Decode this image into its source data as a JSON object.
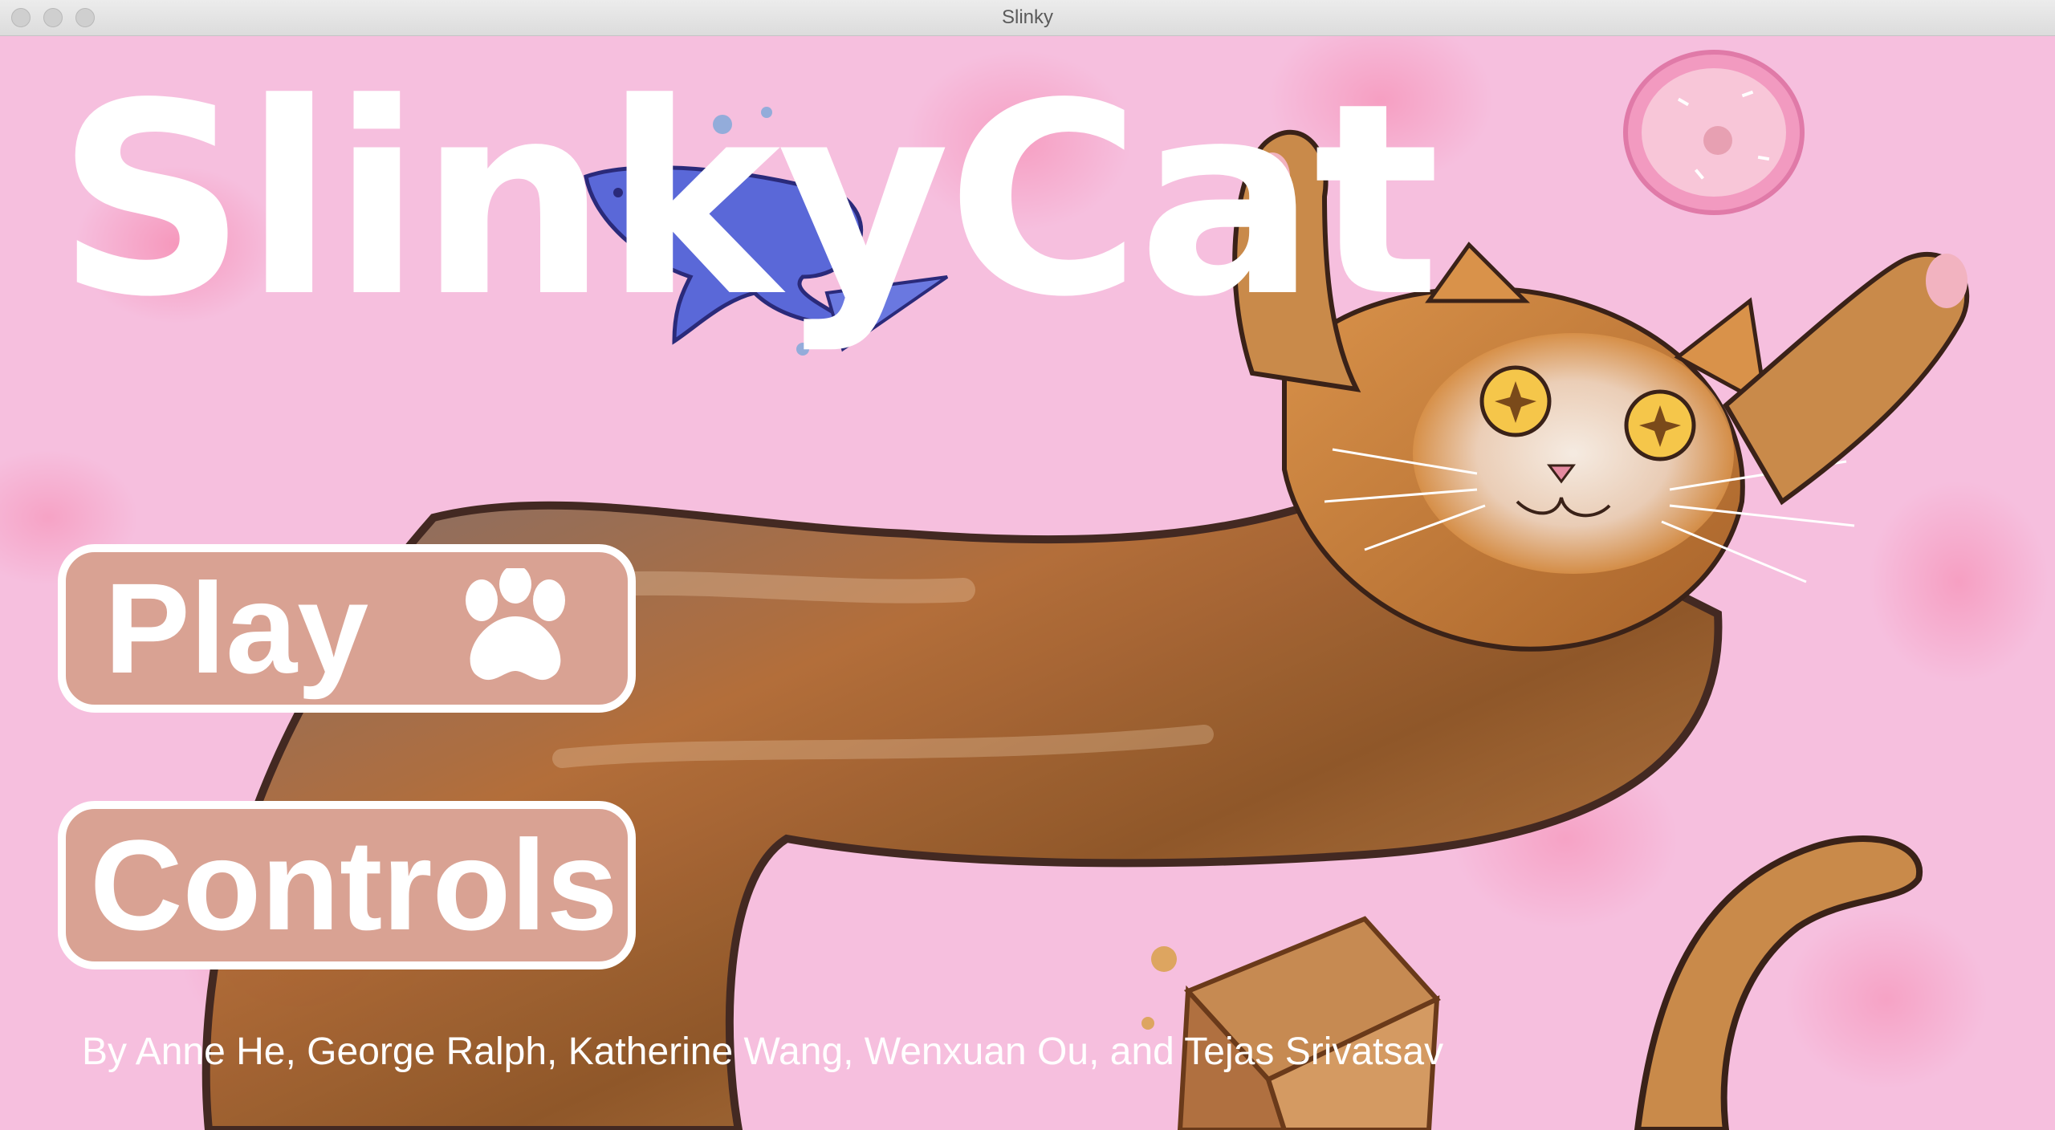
{
  "window": {
    "title": "Slinky"
  },
  "game": {
    "title": "SlinkyCat"
  },
  "menu": {
    "play_label": "Play",
    "controls_label": "Controls"
  },
  "credits": "By Anne He, George Ralph, Katherine Wang, Wenxuan Ou, and Tejas Srivatsav",
  "colors": {
    "background": "#f6bfde",
    "button_fill": "#d9a293",
    "text": "#ffffff"
  },
  "icons": [
    "paw-icon",
    "fish-icon",
    "donut-icon",
    "box-icon"
  ]
}
